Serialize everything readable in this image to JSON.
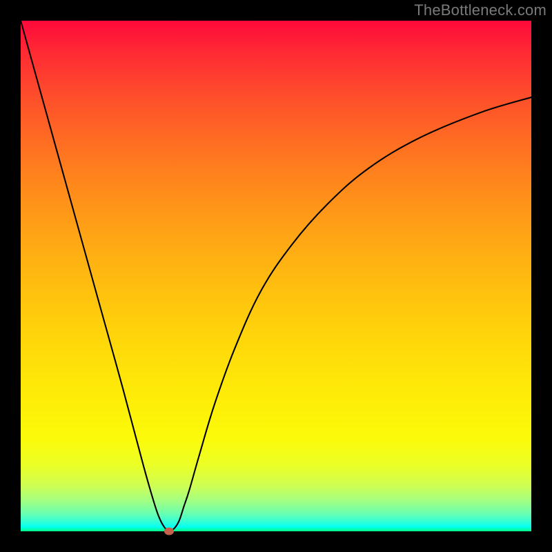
{
  "watermark": "TheBottleneck.com",
  "chart_data": {
    "type": "line",
    "title": "",
    "xlabel": "",
    "ylabel": "",
    "xlim": [
      0,
      100
    ],
    "ylim": [
      0,
      100
    ],
    "grid": false,
    "series": [
      {
        "name": "curve",
        "x": [
          0,
          5,
          10,
          15,
          20,
          24,
          26,
          27,
          28,
          29,
          30,
          31,
          32,
          33,
          35,
          38,
          42,
          47,
          53,
          60,
          68,
          78,
          90,
          100
        ],
        "values": [
          100,
          82,
          64,
          46,
          28,
          13,
          6,
          3,
          1,
          0,
          0.5,
          2,
          5,
          8,
          15,
          25,
          36,
          47,
          56,
          64,
          71,
          77,
          82,
          85
        ]
      }
    ],
    "marker": {
      "x": 29,
      "y": 0,
      "color": "#c5624c"
    },
    "gradient": {
      "top": "#fe093a",
      "mid": "#ffda0a",
      "bottom": "#02ff81"
    }
  }
}
